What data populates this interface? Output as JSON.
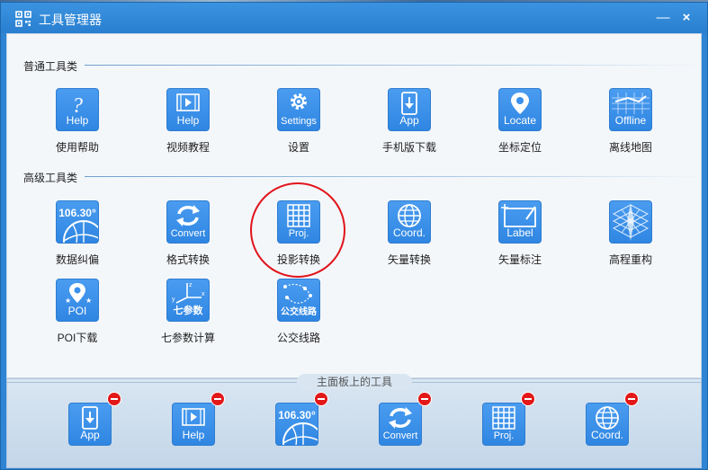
{
  "window": {
    "title": "工具管理器",
    "minimize_label": "—",
    "close_label": "×"
  },
  "sections": {
    "general": "普通工具类",
    "advanced": "高级工具类"
  },
  "general_tools": [
    {
      "caption": "Help",
      "label": "使用帮助",
      "icon": "question-icon"
    },
    {
      "caption": "Help",
      "label": "视频教程",
      "icon": "film-icon"
    },
    {
      "caption": "Settings",
      "label": "设置",
      "icon": "gear-icon"
    },
    {
      "caption": "App",
      "label": "手机版下载",
      "icon": "phone-download-icon"
    },
    {
      "caption": "Locate",
      "label": "坐标定位",
      "icon": "map-pin-icon"
    },
    {
      "caption": "Offline",
      "label": "离线地图",
      "icon": "offline-map-icon"
    }
  ],
  "advanced_tools": [
    {
      "caption": "106.30°",
      "label": "数据纠偏",
      "icon": "globe-quarter-icon"
    },
    {
      "caption": "Convert",
      "label": "格式转换",
      "icon": "convert-arrows-icon"
    },
    {
      "caption": "Proj.",
      "label": "投影转换",
      "icon": "grid-icon"
    },
    {
      "caption": "Coord.",
      "label": "矢量转换",
      "icon": "globe-icon"
    },
    {
      "caption": "Label",
      "label": "矢量标注",
      "icon": "label-icon"
    },
    {
      "caption": "",
      "label": "高程重构",
      "icon": "elevation-icon"
    },
    {
      "caption": "POI",
      "label": "POI下载",
      "icon": "poi-pin-icon"
    },
    {
      "caption": "七参数",
      "label": "七参数计算",
      "icon": "axes-icon"
    },
    {
      "caption": "公交线路",
      "label": "公交线路",
      "icon": "bus-route-icon"
    }
  ],
  "footer": {
    "title": "主面板上的工具",
    "pinned": [
      {
        "caption": "App",
        "icon": "phone-download-icon"
      },
      {
        "caption": "Help",
        "icon": "film-icon"
      },
      {
        "caption": "106.30°",
        "icon": "globe-quarter-icon"
      },
      {
        "caption": "Convert",
        "icon": "convert-arrows-icon"
      },
      {
        "caption": "Proj.",
        "icon": "grid-icon"
      },
      {
        "caption": "Coord.",
        "icon": "globe-icon"
      }
    ]
  },
  "colors": {
    "titlebar": "#2f84d4",
    "tile": "#3a90ea",
    "highlight": "#e0141c",
    "remove_badge": "#e31818"
  }
}
